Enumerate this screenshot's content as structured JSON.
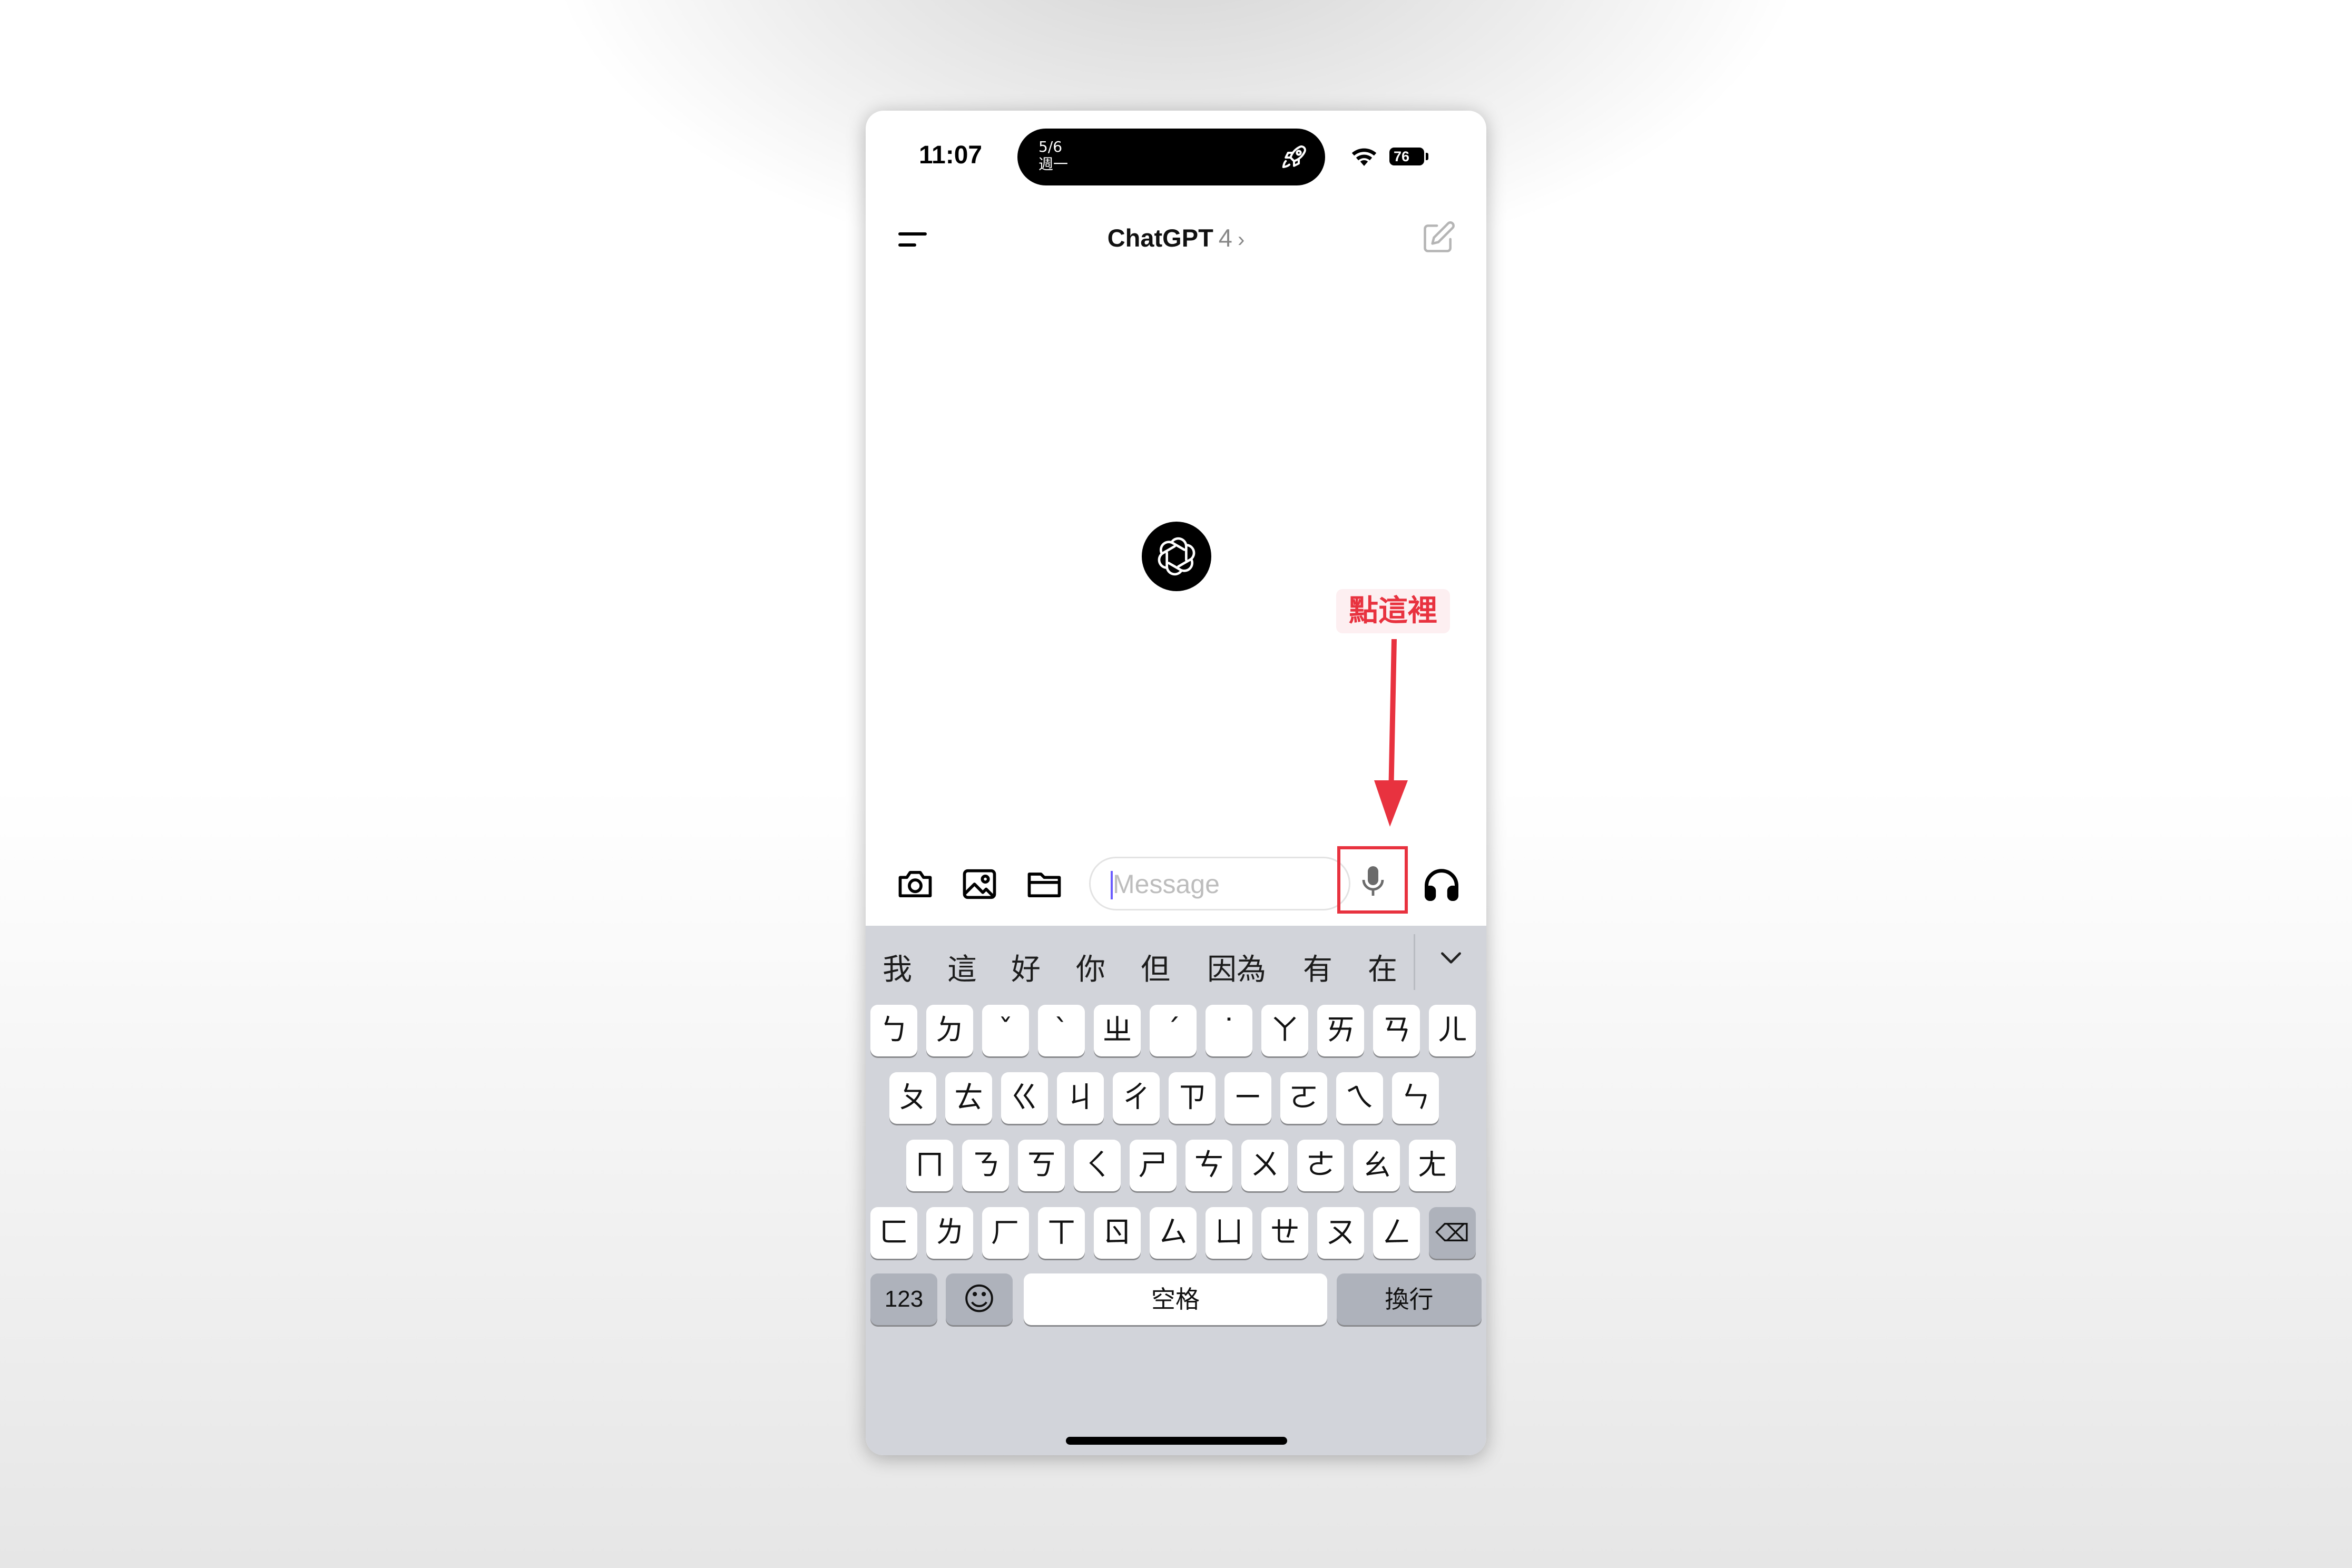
{
  "status_bar": {
    "time": "11:07",
    "island_date": "5/6",
    "island_weekday": "週一",
    "battery": "76"
  },
  "header": {
    "title": "ChatGPT",
    "model": "4",
    "chevron": "›",
    "menu_icon": "menu-icon",
    "edit_icon": "new-chat-icon"
  },
  "annotation": {
    "text": "點這裡",
    "color": "#e8323f"
  },
  "composer": {
    "placeholder": "Message",
    "icons": [
      "camera-icon",
      "photo-icon",
      "folder-icon",
      "microphone-icon",
      "headphones-icon"
    ]
  },
  "keyboard": {
    "candidates": [
      "我",
      "這",
      "好",
      "你",
      "但",
      "因為",
      "有",
      "在"
    ],
    "rows": [
      [
        "ㄅ",
        "ㄉ",
        "ˇ",
        "ˋ",
        "ㄓ",
        "ˊ",
        "˙",
        "ㄚ",
        "ㄞ",
        "ㄢ",
        "ㄦ"
      ],
      [
        "ㄆ",
        "ㄊ",
        "ㄍ",
        "ㄐ",
        "ㄔ",
        "ㄗ",
        "ㄧ",
        "ㄛ",
        "ㄟ",
        "ㄣ"
      ],
      [
        "ㄇ",
        "ㄋ",
        "ㄎ",
        "ㄑ",
        "ㄕ",
        "ㄘ",
        "ㄨ",
        "ㄜ",
        "ㄠ",
        "ㄤ"
      ],
      [
        "ㄈ",
        "ㄌ",
        "ㄏ",
        "ㄒ",
        "ㄖ",
        "ㄙ",
        "ㄩ",
        "ㄝ",
        "ㄡ",
        "ㄥ"
      ]
    ],
    "backspace": "⌫",
    "numbers_key": "123",
    "emoji_key": "☺",
    "space_key": "空格",
    "return_key": "換行"
  },
  "colors": {
    "accent_red": "#e8323f",
    "keyboard_bg": "#d2d4da"
  }
}
